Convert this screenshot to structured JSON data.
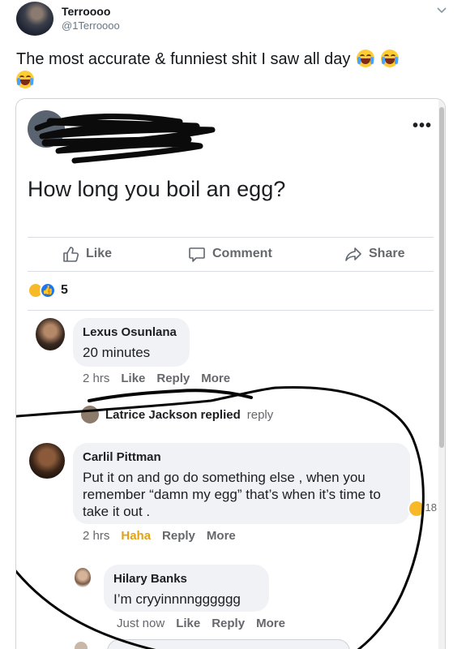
{
  "tweet": {
    "name": "Terroooo",
    "handle": "@1Terroooo",
    "text": "The most accurate & funniest shit I saw all day",
    "emoji_icons": [
      "face-with-tears-of-joy",
      "face-with-tears-of-joy",
      "face-with-tears-of-joy"
    ]
  },
  "post": {
    "question": "How long you boil an egg?",
    "menu_icon": "more-dots",
    "actions": {
      "like": "Like",
      "comment": "Comment",
      "share": "Share"
    },
    "reaction_count": "5",
    "reaction_icons": [
      "haha-reaction",
      "like-reaction"
    ]
  },
  "comments": [
    {
      "name": "Lexus Osunlana",
      "body": "20 minutes",
      "meta": {
        "time": "2 hrs",
        "like": "Like",
        "reply": "Reply",
        "more": "More"
      }
    },
    {
      "name": "Carlil Pittman",
      "body": "Put it on and go do something else , when you remember “damn my egg” that’s when it’s time to take it out .",
      "meta": {
        "time": "2 hrs",
        "like": "Haha",
        "reply": "Reply",
        "more": "More"
      },
      "reaction_count": "18"
    }
  ],
  "reply_summary": {
    "text": "Latrice Jackson replied",
    "suffix": "reply"
  },
  "reply": {
    "name": "Hilary Banks",
    "body": "I’m cryyinnnngggggg",
    "meta": {
      "time": "Just now",
      "like": "Like",
      "reply": "Reply",
      "more": "More"
    }
  },
  "colors": {
    "fb_blue": "#1877f2",
    "haha_yellow": "#f7b928",
    "twitter_gray": "#657786"
  }
}
